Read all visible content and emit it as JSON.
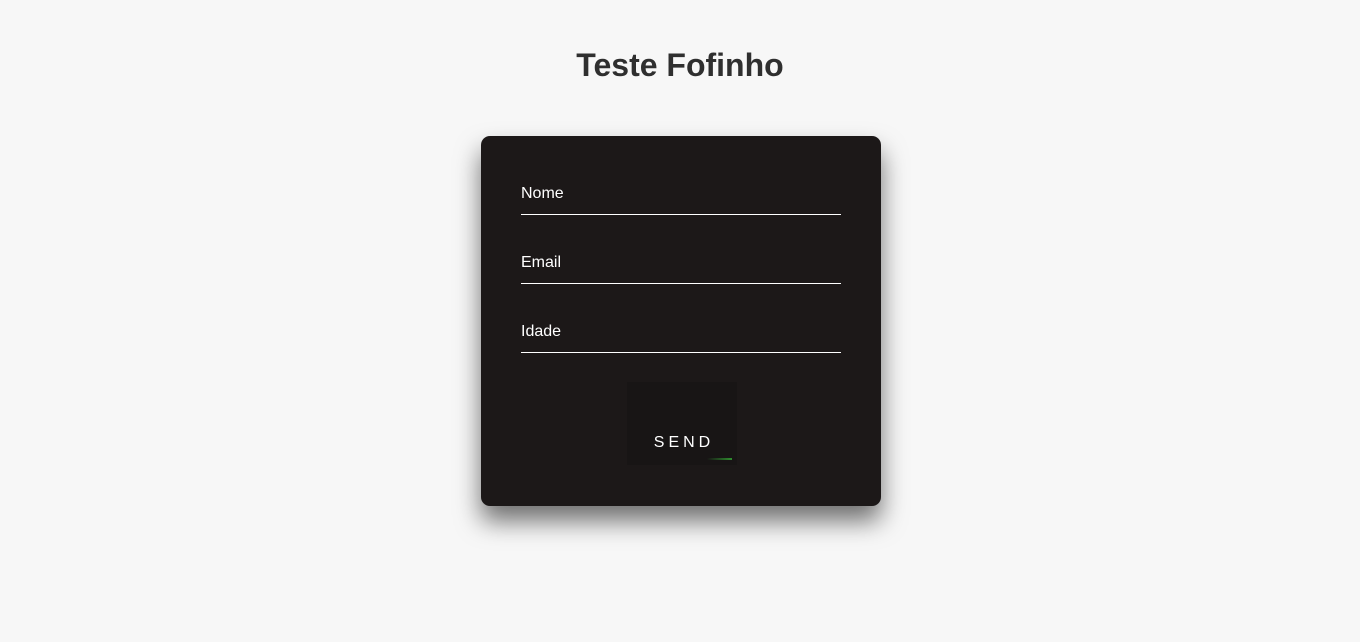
{
  "page": {
    "title": "Teste Fofinho"
  },
  "form": {
    "fields": [
      {
        "label": "Nome"
      },
      {
        "label": "Email"
      },
      {
        "label": "Idade"
      }
    ],
    "submit_label": "SEND"
  },
  "colors": {
    "background": "#f7f7f7",
    "card": "#1c1818",
    "button": "#181515",
    "accent": "#2f8f2f",
    "title": "#2f2f2f"
  }
}
